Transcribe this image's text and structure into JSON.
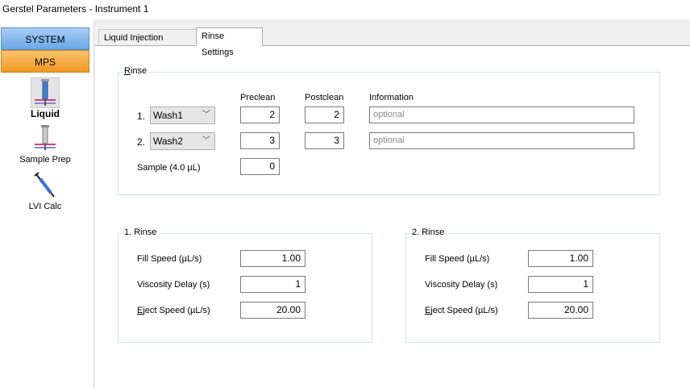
{
  "window": {
    "title": "Gerstel Parameters - Instrument 1"
  },
  "sidebar": {
    "system_label": "SYSTEM",
    "mps_label": "MPS",
    "items": [
      {
        "label": "Liquid",
        "icon": "liquid-syringe-icon",
        "selected": true
      },
      {
        "label": "Sample Prep",
        "icon": "sample-prep-icon",
        "selected": false
      },
      {
        "label": "LVI Calc",
        "icon": "lvi-calc-syringe-icon",
        "selected": false
      }
    ]
  },
  "tabs": [
    {
      "label": "Liquid Injection Settings",
      "active": false
    },
    {
      "label": "Rinse Settings",
      "active": true
    }
  ],
  "rinse": {
    "legend_hotkey": "R",
    "legend_rest": "inse",
    "col_preclean": "Preclean",
    "col_postclean": "Postclean",
    "col_information": "Information",
    "rows": [
      {
        "index": "1.",
        "wash": "Wash1",
        "preclean": "2",
        "postclean": "2",
        "info_placeholder": "optional"
      },
      {
        "index": "2.",
        "wash": "Wash2",
        "preclean": "3",
        "postclean": "3",
        "info_placeholder": "optional"
      }
    ],
    "sample_label": "Sample  (4.0 µL)",
    "sample_value": "0"
  },
  "rinse1": {
    "legend": "1. Rinse",
    "fill_speed_label": "Fill Speed (µL/s)",
    "fill_speed": "1.00",
    "viscosity_delay_label": "Viscosity Delay (s)",
    "viscosity_delay": "1",
    "eject_speed_hotkey": "E",
    "eject_speed_label_rest": "ject Speed (µL/s)",
    "eject_speed": "20.00"
  },
  "rinse2": {
    "legend": "2. Rinse",
    "fill_speed_label": "Fill Speed (µL/s)",
    "fill_speed": "1.00",
    "viscosity_delay_label": "Viscosity Delay (s)",
    "viscosity_delay": "1",
    "eject_speed_hotkey": "E",
    "eject_speed_label_rest": "ject Speed (µL/s)",
    "eject_speed": "20.00"
  },
  "colors": {
    "system_button": "#6aa7e8",
    "mps_button": "#f19a22",
    "group_border": "#d5dfe5"
  }
}
